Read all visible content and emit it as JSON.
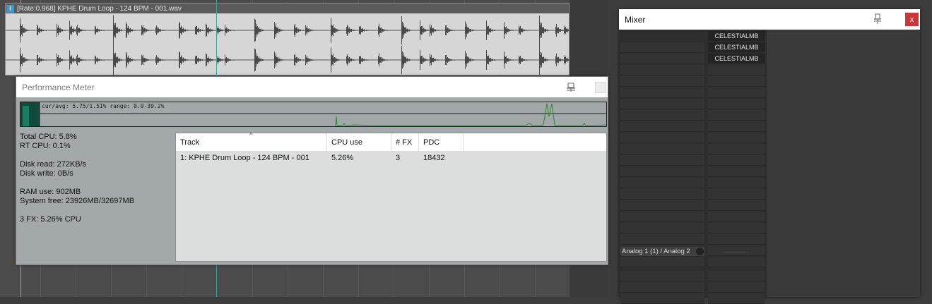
{
  "arrange": {
    "media_item": {
      "title": "[Rate:0.968] KPHE Drum Loop - 124 BPM - 001.wav",
      "info_icon": "info-icon"
    }
  },
  "performance_meter": {
    "title": "Performance Meter",
    "pin_icon": "pin-icon",
    "graph_text": "cur/avg: 5.75/1.51%  range: 0.0-39.2%",
    "cpu_current_percent": 5.75,
    "stats": {
      "total_cpu": "Total CPU: 5.8%",
      "rt_cpu": "RT CPU: 0.1%",
      "disk_read": "Disk read: 272KB/s",
      "disk_write": "Disk write: 0B/s",
      "ram_use": "RAM use: 902MB",
      "system_free": "System free: 23926MB/32697MB",
      "fx_cpu": "3 FX: 5.26% CPU"
    },
    "columns": [
      "Track",
      "CPU use",
      "# FX",
      "PDC"
    ],
    "rows": [
      {
        "track": "1: KPHE Drum Loop - 124 BPM - 001",
        "cpu_use": "5.26%",
        "fx": "3",
        "pdc": "18432"
      }
    ],
    "sort_icon": "^"
  },
  "mixer": {
    "title": "Mixer",
    "close_label": "x",
    "fx_slots": [
      "CELESTIALMB",
      "CELESTIALMB",
      "CELESTIALMB"
    ],
    "io_label": "Analog 1 (1) / Analog 2"
  },
  "colors": {
    "cursor": "#c9a227",
    "playhead": "#3ba3a3",
    "graph_line": "#2b8a2b",
    "mixer_close": "#c8383a"
  }
}
